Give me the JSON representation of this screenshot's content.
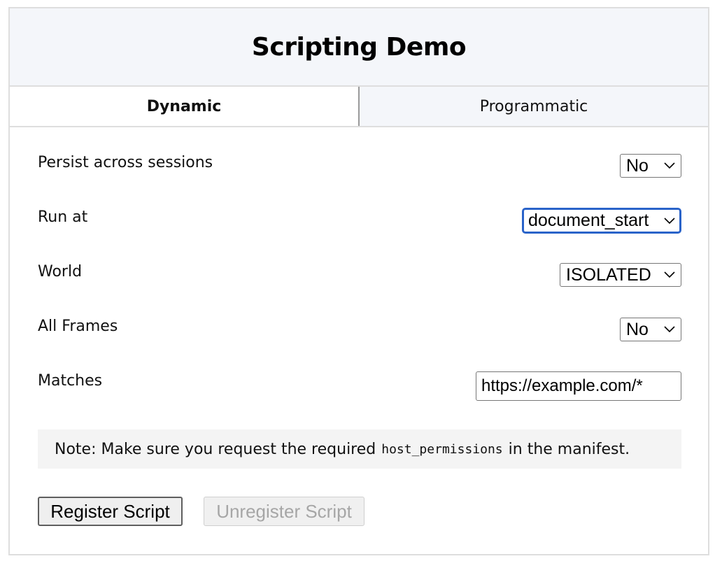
{
  "header": {
    "title": "Scripting Demo"
  },
  "tabs": [
    {
      "label": "Dynamic",
      "active": true
    },
    {
      "label": "Programmatic",
      "active": false
    }
  ],
  "form": {
    "persist": {
      "label": "Persist across sessions",
      "value": "No"
    },
    "run_at": {
      "label": "Run at",
      "value": "document_start"
    },
    "world": {
      "label": "World",
      "value": "ISOLATED"
    },
    "all_frames": {
      "label": "All Frames",
      "value": "No"
    },
    "matches": {
      "label": "Matches",
      "value": "https://example.com/*"
    }
  },
  "note": {
    "prefix": "Note: Make sure you request the required",
    "code": "host_permissions",
    "suffix": "in the manifest."
  },
  "buttons": {
    "register": "Register Script",
    "unregister": "Unregister Script"
  },
  "colors": {
    "header_bg": "#f4f6fa",
    "focus_ring": "#2a63c9",
    "note_bg": "#f4f4f4",
    "disabled_text": "#a6a6a6"
  }
}
